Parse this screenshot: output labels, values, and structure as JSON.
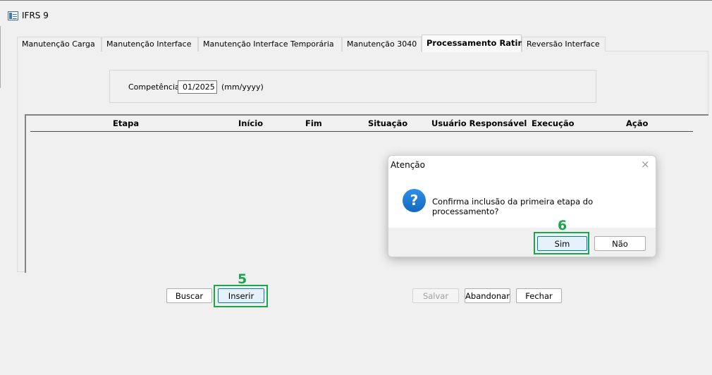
{
  "window": {
    "title": "IFRS 9"
  },
  "tabs": [
    {
      "label": "Manutenção Carga"
    },
    {
      "label": "Manutenção Interface"
    },
    {
      "label": "Manutenção Interface Temporária"
    },
    {
      "label": "Manutenção 3040"
    },
    {
      "label": "Processamento Rating"
    },
    {
      "label": "Reversão Interface"
    }
  ],
  "competencia": {
    "label": "Competência",
    "value": "01/2025",
    "hint": "(mm/yyyy)"
  },
  "grid": {
    "columns": [
      "Etapa",
      "Início",
      "Fim",
      "Situação",
      "Usuário Responsável",
      "Execução",
      "Ação"
    ]
  },
  "buttons": {
    "buscar": "Buscar",
    "inserir": "Inserir",
    "salvar": "Salvar",
    "abandonar": "Abandonar",
    "fechar": "Fechar"
  },
  "dialog": {
    "title": "Atenção",
    "close": "×",
    "icon": "question-icon",
    "message": "Confirma inclusão da primeira etapa do processamento?",
    "yes": "Sim",
    "no": "Não"
  },
  "callouts": {
    "inserir": "5",
    "sim": "6"
  },
  "colors": {
    "highlight": "#1aa64b",
    "accent": "#0078d4",
    "question": "#1a78d4"
  }
}
